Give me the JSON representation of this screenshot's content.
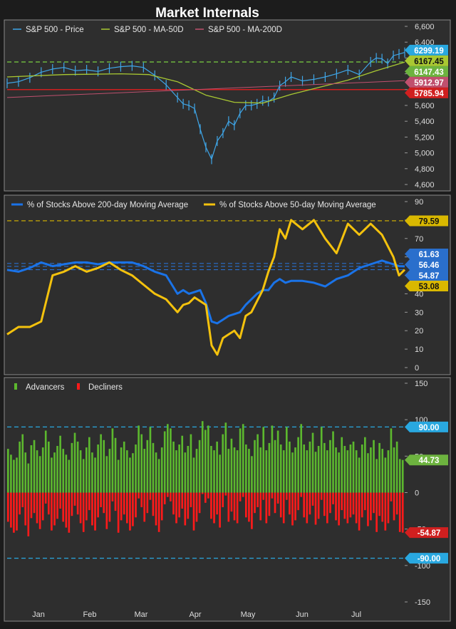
{
  "title": "Market Internals",
  "x_labels": [
    "Jan",
    "Feb",
    "Mar",
    "Apr",
    "May",
    "Jun",
    "Jul"
  ],
  "colors": {
    "price": "#3fa6e8",
    "ma50": "#a9c832",
    "ma200": "#c0506e",
    "above200": "#1a73e8",
    "above50": "#f4c20d",
    "advancers": "#5cb82e",
    "decliners": "#ff1a1a",
    "ref_green": "#6db33f",
    "ref_red": "#d01f1f",
    "ref_yellow": "#d9b800",
    "ref_blue": "#2a6fcc",
    "ref_cyan": "#29a8e0"
  },
  "chart_data": [
    {
      "type": "line",
      "legend": [
        "S&P 500 - Price",
        "S&P 500 - MA-50D",
        "S&P 500 - MA-200D"
      ],
      "ylim": [
        4600,
        6600
      ],
      "yticks": [
        "6,600",
        "6,400",
        "6,200",
        "6,000",
        "5,800",
        "5,600",
        "5,400",
        "5,200",
        "5,000",
        "4,800",
        "4,600"
      ],
      "series": [
        {
          "name": "S&P 500 - Price",
          "x": [
            0,
            4,
            8,
            12,
            16,
            20,
            24,
            28,
            32,
            36,
            40,
            44,
            48,
            52,
            56,
            60,
            62,
            64,
            66,
            68,
            70,
            72,
            74,
            76,
            78,
            80,
            82,
            84,
            86,
            88,
            90,
            92,
            94,
            96,
            98,
            100,
            104,
            108,
            112,
            116,
            120,
            124,
            128,
            130,
            132,
            134,
            136,
            138,
            140
          ],
          "values": [
            5880,
            5900,
            5950,
            6020,
            6060,
            6080,
            6040,
            6050,
            6030,
            6070,
            6090,
            6100,
            6080,
            5980,
            5860,
            5700,
            5620,
            5600,
            5560,
            5300,
            5070,
            4920,
            5150,
            5250,
            5400,
            5350,
            5500,
            5600,
            5600,
            5620,
            5660,
            5650,
            5700,
            5850,
            5900,
            5960,
            5910,
            5930,
            5960,
            6000,
            6050,
            5990,
            6150,
            6200,
            6190,
            6130,
            6230,
            6250,
            6270
          ]
        },
        {
          "name": "S&P 500 - MA-50D",
          "x": [
            0,
            20,
            40,
            50,
            60,
            70,
            80,
            90,
            100,
            110,
            120,
            130,
            140
          ],
          "values": [
            5960,
            5990,
            6000,
            5990,
            5900,
            5730,
            5640,
            5630,
            5740,
            5830,
            5920,
            6040,
            6147.43
          ]
        },
        {
          "name": "S&P 500 - MA-200D",
          "x": [
            0,
            140
          ],
          "values": [
            5700,
            5912.97
          ]
        }
      ],
      "labels": [
        "6299.19",
        "6167.45",
        "6147.43",
        "5912.97",
        "5785.94"
      ],
      "ref_lines": [
        6150,
        5800
      ]
    },
    {
      "type": "line",
      "legend": [
        "% of Stocks Above 200-day Moving Average",
        "% of Stocks Above 50-day Moving Average"
      ],
      "ylim": [
        0,
        90
      ],
      "yticks": [
        "90",
        "80",
        "70",
        "60",
        "50",
        "40",
        "30",
        "20",
        "10",
        "0"
      ],
      "series": [
        {
          "name": "% of Stocks Above 200-day Moving Average",
          "x": [
            0,
            4,
            8,
            12,
            16,
            20,
            24,
            28,
            32,
            36,
            40,
            44,
            48,
            52,
            56,
            60,
            62,
            64,
            66,
            68,
            70,
            72,
            74,
            76,
            78,
            80,
            82,
            84,
            86,
            88,
            90,
            92,
            94,
            96,
            98,
            100,
            104,
            108,
            112,
            116,
            120,
            124,
            128,
            132,
            136,
            138,
            140
          ],
          "values": [
            53,
            52,
            54,
            57,
            55,
            56,
            57,
            57,
            56,
            57,
            57,
            57,
            55,
            52,
            50,
            40,
            42,
            40,
            41,
            42,
            35,
            25,
            24,
            26,
            28,
            29,
            30,
            34,
            37,
            40,
            42,
            42,
            46,
            48,
            46,
            47,
            47,
            46,
            44,
            48,
            50,
            54,
            56,
            58,
            56,
            55,
            54.87
          ]
        },
        {
          "name": "% of Stocks Above 50-day Moving Average",
          "x": [
            0,
            4,
            8,
            12,
            16,
            20,
            24,
            28,
            32,
            36,
            40,
            44,
            48,
            52,
            56,
            60,
            62,
            64,
            66,
            68,
            70,
            72,
            74,
            76,
            78,
            80,
            82,
            84,
            86,
            88,
            90,
            92,
            94,
            96,
            98,
            100,
            104,
            108,
            112,
            116,
            120,
            124,
            128,
            132,
            136,
            138,
            140
          ],
          "values": [
            18,
            22,
            22,
            25,
            50,
            52,
            55,
            52,
            54,
            57,
            53,
            50,
            45,
            40,
            37,
            30,
            34,
            35,
            38,
            36,
            34,
            12,
            7,
            16,
            18,
            20,
            16,
            28,
            30,
            36,
            42,
            52,
            60,
            75,
            70,
            80,
            75,
            80,
            70,
            62,
            78,
            72,
            78,
            72,
            60,
            50,
            53.08
          ]
        }
      ],
      "labels": [
        "79.59",
        "61.63",
        "56.46",
        "54.87",
        "53.08"
      ],
      "ref_lines": [
        79.59,
        56.46,
        54.87,
        53.08
      ]
    },
    {
      "type": "bar",
      "legend": [
        "Advancers",
        "Decliners"
      ],
      "ylim": [
        -150,
        150
      ],
      "yticks": [
        "150",
        "100",
        "50",
        "0",
        "-50",
        "-100",
        "-150"
      ],
      "series": [
        {
          "name": "Advancers",
          "values": [
            60,
            52,
            45,
            48,
            70,
            80,
            55,
            40,
            65,
            72,
            58,
            50,
            62,
            85,
            70,
            48,
            55,
            64,
            78,
            60,
            52,
            45,
            68,
            82,
            70,
            58,
            46,
            62,
            76,
            55,
            48,
            66,
            80,
            72,
            50,
            60,
            88,
            75,
            45,
            62,
            70,
            58,
            48,
            54,
            66,
            92,
            80,
            60,
            72,
            90,
            68,
            55,
            46,
            62,
            84,
            94,
            88,
            70,
            58,
            66,
            78,
            55,
            64,
            80,
            48,
            60,
            72,
            98,
            86,
            92,
            64,
            58,
            70,
            52,
            80,
            96,
            60,
            74,
            62,
            58,
            88,
            94,
            66,
            60,
            50,
            72,
            80,
            62,
            90,
            58,
            68,
            92,
            72,
            85,
            66,
            58,
            90,
            70,
            55,
            62,
            76,
            94,
            66,
            58,
            70,
            82,
            56,
            64,
            90,
            68,
            58,
            72,
            84,
            62,
            55,
            76,
            64,
            58,
            66,
            70,
            58,
            48,
            66,
            76,
            54,
            62,
            72,
            46,
            68,
            60,
            48,
            58,
            88,
            62,
            70,
            46,
            44.73
          ]
        },
        {
          "name": "Decliners",
          "values": [
            -40,
            -48,
            -55,
            -52,
            -30,
            -20,
            -45,
            -60,
            -35,
            -28,
            -42,
            -50,
            -38,
            -15,
            -30,
            -52,
            -45,
            -36,
            -22,
            -40,
            -48,
            -55,
            -32,
            -18,
            -30,
            -42,
            -54,
            -38,
            -24,
            -45,
            -52,
            -34,
            -20,
            -28,
            -50,
            -40,
            -12,
            -25,
            -55,
            -38,
            -30,
            -42,
            -52,
            -46,
            -34,
            -8,
            -20,
            -40,
            -28,
            -10,
            -32,
            -45,
            -54,
            -38,
            -16,
            -6,
            -12,
            -30,
            -42,
            -34,
            -22,
            -45,
            -36,
            -20,
            -52,
            -40,
            -28,
            -2,
            -14,
            -8,
            -36,
            -42,
            -30,
            -48,
            -20,
            -4,
            -40,
            -26,
            -38,
            -42,
            -12,
            -6,
            -34,
            -40,
            -50,
            -28,
            -20,
            -38,
            -10,
            -42,
            -32,
            -8,
            -28,
            -15,
            -34,
            -42,
            -10,
            -30,
            -45,
            -38,
            -24,
            -6,
            -34,
            -42,
            -30,
            -18,
            -44,
            -36,
            -10,
            -32,
            -42,
            -28,
            -16,
            -38,
            -45,
            -24,
            -36,
            -42,
            -34,
            -30,
            -42,
            -52,
            -34,
            -24,
            -46,
            -38,
            -28,
            -54,
            -32,
            -40,
            -52,
            -42,
            -12,
            -38,
            -30,
            -54,
            -54.87
          ]
        }
      ],
      "labels": [
        "90.00",
        "44.73",
        "-54.87",
        "-90.00"
      ],
      "ref_lines": [
        90,
        -90
      ]
    }
  ]
}
